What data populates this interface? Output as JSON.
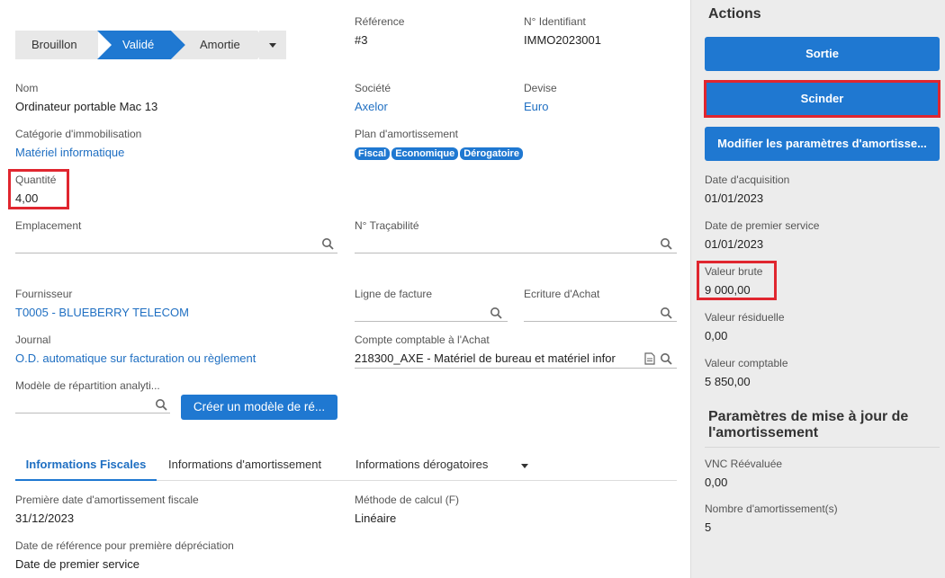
{
  "status": {
    "steps": [
      "Brouillon",
      "Validé",
      "Amortie"
    ]
  },
  "fields": {
    "reference": {
      "label": "Référence",
      "value": "#3"
    },
    "identifiant": {
      "label": "N° Identifiant",
      "value": "IMMO2023001"
    },
    "nom": {
      "label": "Nom",
      "value": "Ordinateur portable Mac 13"
    },
    "societe": {
      "label": "Société",
      "value": "Axelor"
    },
    "devise": {
      "label": "Devise",
      "value": "Euro"
    },
    "categorie": {
      "label": "Catégorie d'immobilisation",
      "value": "Matériel informatique"
    },
    "plan": {
      "label": "Plan d'amortissement",
      "tags": [
        "Fiscal",
        "Economique",
        "Dérogatoire"
      ]
    },
    "quantite": {
      "label": "Quantité",
      "value": "4,00"
    },
    "emplacement": {
      "label": "Emplacement",
      "value": ""
    },
    "tracabilite": {
      "label": "N° Traçabilité",
      "value": ""
    },
    "fournisseur": {
      "label": "Fournisseur",
      "value": "T0005 - BLUEBERRY TELECOM"
    },
    "ligne_facture": {
      "label": "Ligne de facture",
      "value": ""
    },
    "ecriture_achat": {
      "label": "Ecriture d'Achat",
      "value": ""
    },
    "journal": {
      "label": "Journal",
      "value": "O.D. automatique sur facturation ou règlement"
    },
    "compte_achat": {
      "label": "Compte comptable à l'Achat",
      "value": "218300_AXE - Matériel de bureau et matériel infor"
    },
    "modele_repartition": {
      "label": "Modèle de répartition analyti...",
      "value": ""
    },
    "creer_modele": "Créer un modèle de ré..."
  },
  "tabs": {
    "fiscal": "Informations Fiscales",
    "amortissement": "Informations d'amortissement",
    "derogatoires": "Informations dérogatoires"
  },
  "fiscal": {
    "premiere_date": {
      "label": "Première date d'amortissement fiscale",
      "value": "31/12/2023"
    },
    "methode": {
      "label": "Méthode de calcul (F)",
      "value": "Linéaire"
    },
    "date_reference": {
      "label": "Date de référence pour première dépréciation",
      "value": "Date de premier service"
    }
  },
  "sidebar": {
    "title": "Actions",
    "btn_sortie": "Sortie",
    "btn_scinder": "Scinder",
    "btn_modifier": "Modifier les paramètres d'amortisse...",
    "date_acquisition": {
      "label": "Date d'acquisition",
      "value": "01/01/2023"
    },
    "date_premier_service": {
      "label": "Date de premier service",
      "value": "01/01/2023"
    },
    "valeur_brute": {
      "label": "Valeur brute",
      "value": "9 000,00"
    },
    "valeur_residuelle": {
      "label": "Valeur résiduelle",
      "value": "0,00"
    },
    "valeur_comptable": {
      "label": "Valeur comptable",
      "value": "5 850,00"
    },
    "params_title": "Paramètres de mise à jour de l'amortissement",
    "vnc": {
      "label": "VNC Réévaluée",
      "value": "0,00"
    },
    "nb_amortissements": {
      "label": "Nombre d'amortissement(s)",
      "value": "5"
    }
  },
  "colors": {
    "accent": "#1f78d1",
    "link": "#1f6fc2",
    "highlight": "#e0262f"
  }
}
